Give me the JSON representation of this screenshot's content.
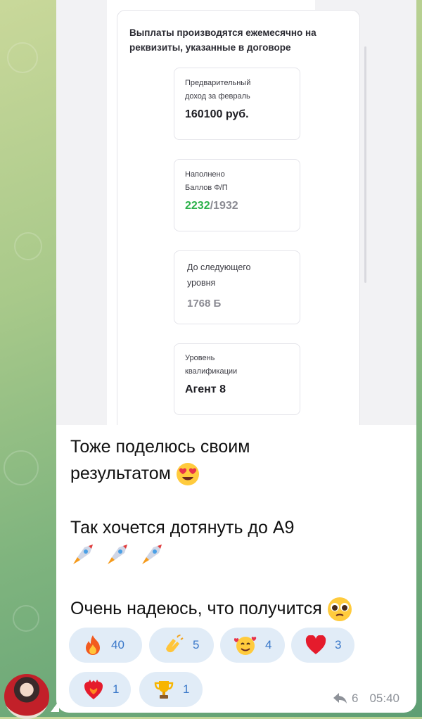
{
  "screenshot": {
    "heading": "Выплаты производятся ежемесячно на реквизиты, указанные в договоре",
    "cards": [
      {
        "label_line1": "Предварительный",
        "label_line2": "доход за февраль",
        "value": "160100 руб."
      },
      {
        "label_line1": "Наполнено",
        "label_line2": "Баллов Ф/П",
        "value_filled": "2232",
        "value_total": "/1932"
      },
      {
        "label_line1": "До следующего",
        "label_line2": "уровня",
        "value": "1768 Б"
      },
      {
        "label_line1": "Уровень",
        "label_line2": "квалификации",
        "value": "Агент 8"
      }
    ]
  },
  "message": {
    "line1": "Тоже поделюсь своим",
    "line2": "результатом",
    "line3": "Так хочется дотянуть до А9",
    "line4": "Очень надеюсь, что получится"
  },
  "reactions": [
    {
      "icon": "fire-emoji",
      "count": "40"
    },
    {
      "icon": "clapping-hands-emoji",
      "count": "5"
    },
    {
      "icon": "smiling-face-with-hearts-emoji",
      "count": "4"
    },
    {
      "icon": "red-heart-emoji",
      "count": "3"
    },
    {
      "icon": "heart-on-fire-emoji",
      "count": "1"
    },
    {
      "icon": "trophy-emoji",
      "count": "1"
    }
  ],
  "meta": {
    "replies": "6",
    "time": "05:40"
  }
}
